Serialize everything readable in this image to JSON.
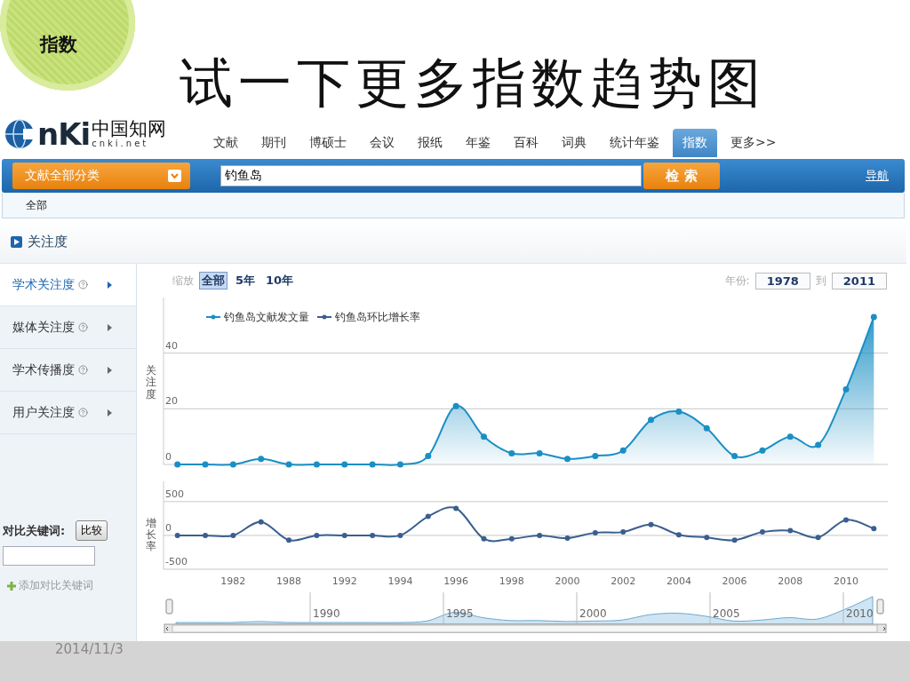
{
  "slide": {
    "badge": "指数",
    "title": "试一下更多指数趋势图",
    "date": "2014/11/3"
  },
  "site": {
    "logo": {
      "mark": "nKi",
      "name": "中国知网",
      "domain": "cnki.net"
    },
    "tabs": [
      {
        "label": "文献",
        "selected": false
      },
      {
        "label": "期刊",
        "selected": false
      },
      {
        "label": "博硕士",
        "selected": false
      },
      {
        "label": "会议",
        "selected": false
      },
      {
        "label": "报纸",
        "selected": false
      },
      {
        "label": "年鉴",
        "selected": false
      },
      {
        "label": "百科",
        "selected": false
      },
      {
        "label": "词典",
        "selected": false
      },
      {
        "label": "统计年鉴",
        "selected": false
      },
      {
        "label": "指数",
        "selected": true
      },
      {
        "label": "更多>>",
        "selected": false
      }
    ],
    "search": {
      "category": "文献全部分类",
      "value": "钓鱼岛",
      "button": "检 索",
      "link": "导航"
    },
    "filter": "全部",
    "section": "关注度",
    "sidebar": {
      "items": [
        {
          "label": "学术关注度",
          "selected": true
        },
        {
          "label": "媒体关注度",
          "selected": false
        },
        {
          "label": "学术传播度",
          "selected": false
        },
        {
          "label": "用户关注度",
          "selected": false
        }
      ],
      "compare": {
        "label": "对比关键词:",
        "button": "比较",
        "add": "添加对比关键词"
      }
    },
    "toolbar": {
      "zoom_label": "缩放",
      "ranges": [
        {
          "label": "全部",
          "selected": true
        },
        {
          "label": "5年",
          "selected": false
        },
        {
          "label": "10年",
          "selected": false
        }
      ],
      "year_label": "年份:",
      "from": "1978",
      "to_label": "到",
      "to": "2011"
    },
    "charts": [
      {
        "chart_data": {
          "type": "area",
          "ylabel": "关注度",
          "ylim": [
            0,
            60
          ],
          "yticks": [
            0,
            20,
            40
          ],
          "series": [
            {
              "name": "钓鱼岛文献发文量",
              "color": "#1a8fc4",
              "marker": true,
              "values": [
                0,
                0,
                0,
                2,
                0,
                0,
                0,
                0,
                0,
                3,
                21,
                10,
                4,
                4,
                2,
                3,
                5,
                16,
                19,
                13,
                3,
                5,
                10,
                7,
                27,
                53
              ]
            }
          ]
        }
      },
      {
        "chart_data": {
          "type": "line",
          "ylabel": "增长率",
          "ylim": [
            -500,
            800
          ],
          "yticks": [
            -500,
            0,
            500
          ],
          "categories": [
            null,
            null,
            "1982",
            null,
            "1988",
            null,
            "1992",
            null,
            "1994",
            null,
            "1996",
            null,
            "1998",
            null,
            "2000",
            null,
            "2002",
            null,
            "2004",
            null,
            "2006",
            null,
            "2008",
            null,
            "2010",
            null
          ],
          "series": [
            {
              "name": "钓鱼岛环比增长率",
              "color": "#3a5f8f",
              "marker": true,
              "values": [
                0,
                0,
                0,
                200,
                -70,
                0,
                0,
                0,
                0,
                280,
                400,
                -50,
                -50,
                0,
                -40,
                40,
                50,
                160,
                10,
                -30,
                -70,
                50,
                70,
                -30,
                230,
                100
              ]
            }
          ]
        }
      }
    ],
    "navigator": {
      "labels": [
        "1990",
        "1995",
        "2000",
        "2005",
        "2010"
      ]
    }
  }
}
